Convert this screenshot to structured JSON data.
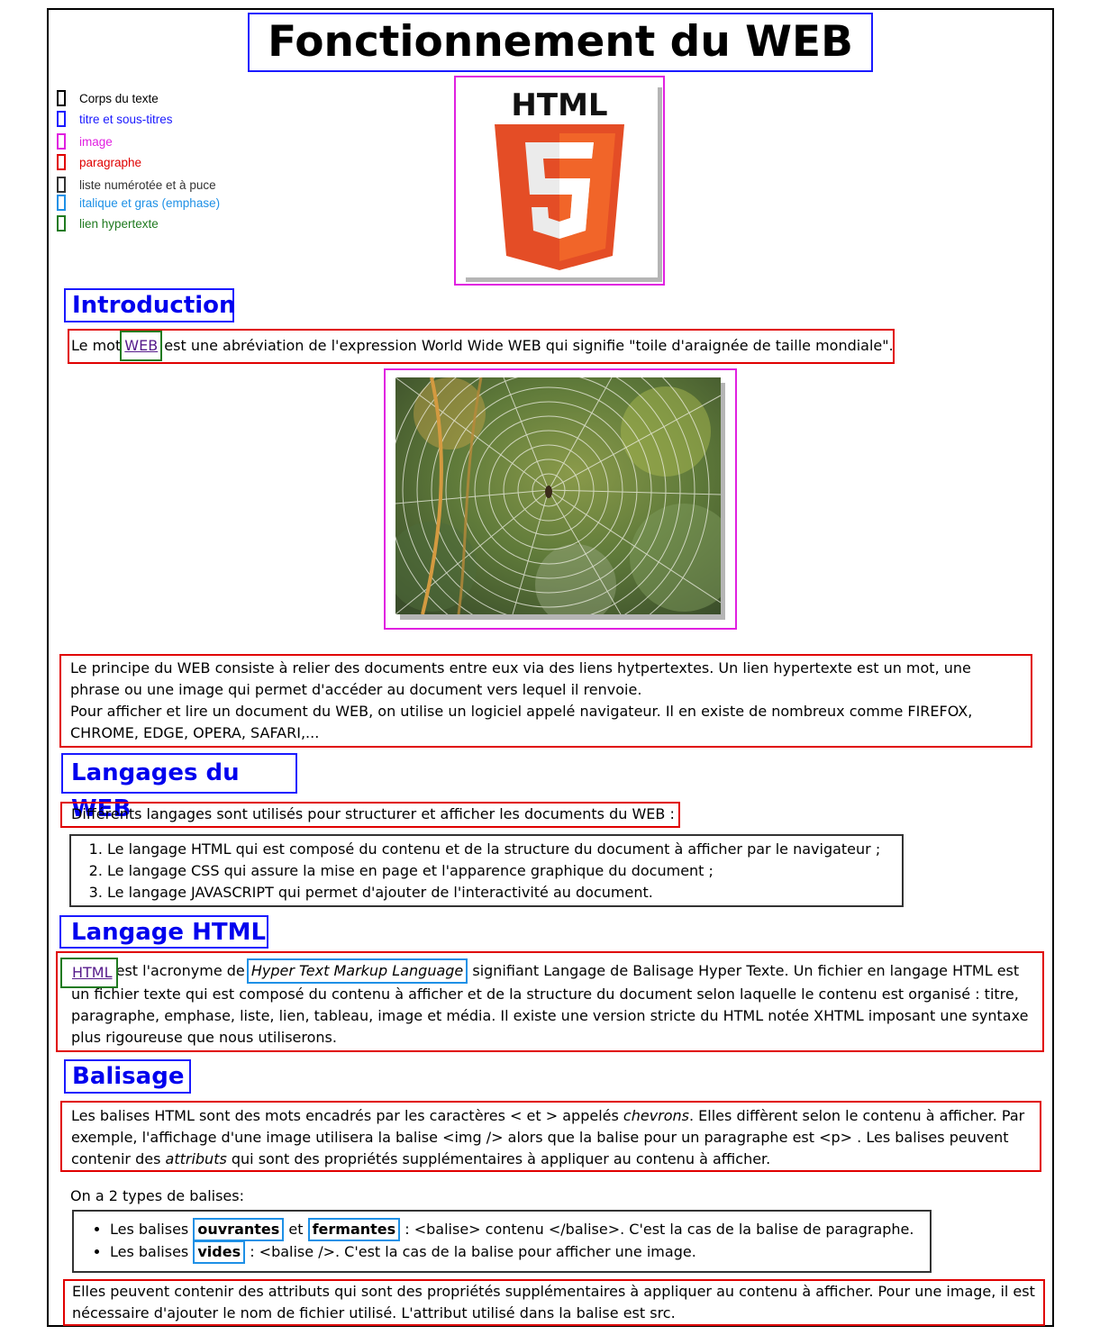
{
  "title": "Fonctionnement du WEB",
  "legend": [
    {
      "label": "Corps du texte",
      "color": "#000000"
    },
    {
      "label": "titre et sous-titres",
      "color": "#1a1aff"
    },
    {
      "label": "image",
      "color": "#e020e0"
    },
    {
      "label": "paragraphe",
      "color": "#e00000"
    },
    {
      "label": "liste numérotée et à puce",
      "color": "#333333"
    },
    {
      "label": "italique et gras (emphase)",
      "color": "#1e90e6"
    },
    {
      "label": "lien hypertexte",
      "color": "#1f7a1f"
    }
  ],
  "logo": {
    "text": "HTML",
    "number": "5"
  },
  "intro": {
    "heading": "Introduction",
    "p1_before": "Le mot ",
    "p1_link": "WEB",
    "p1_after": " est une abréviation de l'expression World Wide WEB qui signifie \"toile d'araignée de taille mondiale\".",
    "p2_line1": "Le principe du WEB consiste à relier des documents entre eux via des liens hytpertextes. Un lien hypertexte est un mot, une phrase ou une image qui permet d'accéder au document vers lequel il renvoie.",
    "p2_line2": "Pour afficher et lire un document du WEB, on utilise un logiciel appelé navigateur. Il en existe de nombreux comme FIREFOX, CHROME, EDGE, OPERA, SAFARI,..."
  },
  "langages": {
    "heading": "Langages du WEB",
    "intro": "Différents langages sont utilisés pour structurer et afficher les documents du WEB :",
    "items": [
      "Le langage HTML qui est composé du contenu et de la structure du document à afficher par le navigateur ;",
      "Le langage CSS qui assure la mise en page et l'apparence graphique du document ;",
      "Le langage JAVASCRIPT qui permet d'ajouter de l'interactivité au document."
    ]
  },
  "html": {
    "heading": "Langage HTML",
    "link": "HTML",
    "t1": " est l'acronyme de ",
    "italic": "Hyper Text Markup Language",
    "t2": " signifiant Langage de Balisage Hyper Texte. Un fichier en langage HTML est un fichier texte qui est composé du contenu à afficher et de la structure du document selon laquelle le contenu est organisé : titre, paragraphe, emphase, liste, lien, tableau, image et média. Il existe une version stricte du HTML notée XHTML imposant une syntaxe plus rigoureuse que nous utiliserons."
  },
  "balisage": {
    "heading": "Balisage",
    "p1_a": "Les balises HTML sont des mots encadrés par les caractères < et > appelés ",
    "p1_em1": "chevrons",
    "p1_b": ". Elles diffèrent selon le contenu à afficher. Par exemple, l'affichage d'une image utilisera la balise <img /> alors que la balise pour un paragraphe est <p> . Les balises peuvent contenir des ",
    "p1_em2": "attributs",
    "p1_c": " qui sont des propriétés supplémentaires à appliquer au contenu à afficher.",
    "types_intro": "On a 2 types de balises:",
    "b1_a": "Les balises ",
    "b1_strong1": "ouvrantes",
    "b1_mid": " et ",
    "b1_strong2": "fermantes",
    "b1_c": " : <balise> contenu </balise>. C'est la cas de la balise de paragraphe.",
    "b2_a": "Les balises ",
    "b2_strong": "vides",
    "b2_c": " : <balise />. C'est la cas de la balise pour afficher une image.",
    "p_last": "Elles peuvent contenir des attributs qui sont des propriétés supplémentaires à appliquer au contenu à afficher. Pour une image, il est nécessaire d'ajouter le nom de fichier utilisé. L'attribut utilisé dans la balise est src."
  }
}
